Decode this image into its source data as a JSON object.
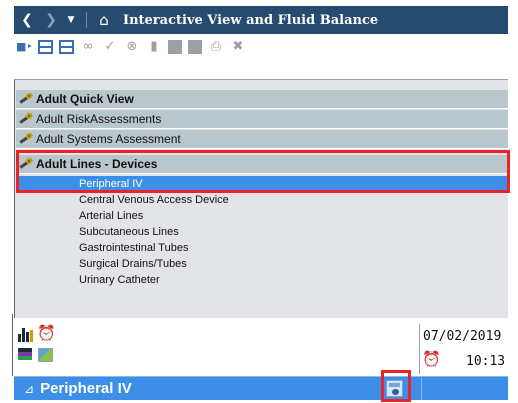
{
  "titlebar": {
    "back_icon": "chevron-left-icon",
    "forward_icon": "chevron-right-icon",
    "dropdown_icon": "caret-down-icon",
    "home_icon": "home-icon",
    "title": "Interactive View and Fluid Balance",
    "bg_color": "#264b6e"
  },
  "toolbar": {
    "icons": [
      "insert-icon",
      "row-icon",
      "grid-add-icon",
      "glasses-icon",
      "check-icon",
      "cancel-icon",
      "folder-icon",
      "document-icon",
      "table-icon",
      "printer-icon",
      "close-icon"
    ]
  },
  "sections": [
    {
      "label": "Adult Quick View",
      "bold": true
    },
    {
      "label": "Adult RiskAssessments",
      "bold": false
    },
    {
      "label": "Adult Systems Assessment",
      "bold": false
    },
    {
      "label": "Adult Lines - Devices",
      "bold": true
    }
  ],
  "items": [
    {
      "label": "Peripheral IV",
      "selected": true
    },
    {
      "label": "Central Venous Access Device",
      "selected": false
    },
    {
      "label": "Arterial Lines",
      "selected": false
    },
    {
      "label": "Subcutaneous Lines",
      "selected": false
    },
    {
      "label": "Gastrointestinal Tubes",
      "selected": false
    },
    {
      "label": "Surgical Drains/Tubes",
      "selected": false
    },
    {
      "label": "Urinary Catheter",
      "selected": false
    }
  ],
  "status": {
    "date": "07/02/2019",
    "time": "10:13"
  },
  "bottom_bar": {
    "collapse_icon": "triangle-icon",
    "title": "Peripheral IV",
    "action_icon": "calculator-icon",
    "bg_color": "#3d8ee6"
  },
  "highlight_color": "#e8232a"
}
